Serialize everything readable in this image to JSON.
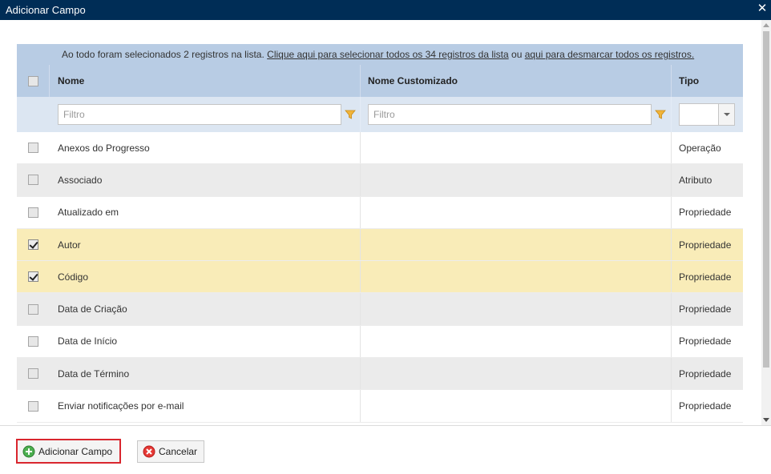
{
  "window": {
    "title": "Adicionar Campo",
    "close_icon": "close-icon"
  },
  "notice": {
    "prefix": "Ao todo foram selecionados 2 registros na lista.",
    "select_all_link": "Clique aqui para selecionar todos os 34 registros da lista",
    "middle": "ou",
    "deselect_link": "aqui para desmarcar todos os registros."
  },
  "columns": {
    "name": "Nome",
    "custom_name": "Nome Customizado",
    "type": "Tipo"
  },
  "filters": {
    "name_placeholder": "Filtro",
    "custom_placeholder": "Filtro",
    "type_value": ""
  },
  "rows": [
    {
      "name": "Anexos do Progresso",
      "custom": "",
      "type": "Operação",
      "checked": false
    },
    {
      "name": "Associado",
      "custom": "",
      "type": "Atributo",
      "checked": false
    },
    {
      "name": "Atualizado em",
      "custom": "",
      "type": "Propriedade",
      "checked": false
    },
    {
      "name": "Autor",
      "custom": "",
      "type": "Propriedade",
      "checked": true
    },
    {
      "name": "Código",
      "custom": "",
      "type": "Propriedade",
      "checked": true
    },
    {
      "name": "Data de Criação",
      "custom": "",
      "type": "Propriedade",
      "checked": false
    },
    {
      "name": "Data de Início",
      "custom": "",
      "type": "Propriedade",
      "checked": false
    },
    {
      "name": "Data de Término",
      "custom": "",
      "type": "Propriedade",
      "checked": false
    },
    {
      "name": "Enviar notificações por e-mail",
      "custom": "",
      "type": "Propriedade",
      "checked": false
    }
  ],
  "footer": {
    "add_label": "Adicionar Campo",
    "cancel_label": "Cancelar"
  },
  "colors": {
    "title_bar": "#002d56",
    "header_bg": "#b8cce4",
    "selected_row": "#f9ecb8",
    "alt_row": "#ebebeb",
    "focus_border": "#d9262e"
  }
}
